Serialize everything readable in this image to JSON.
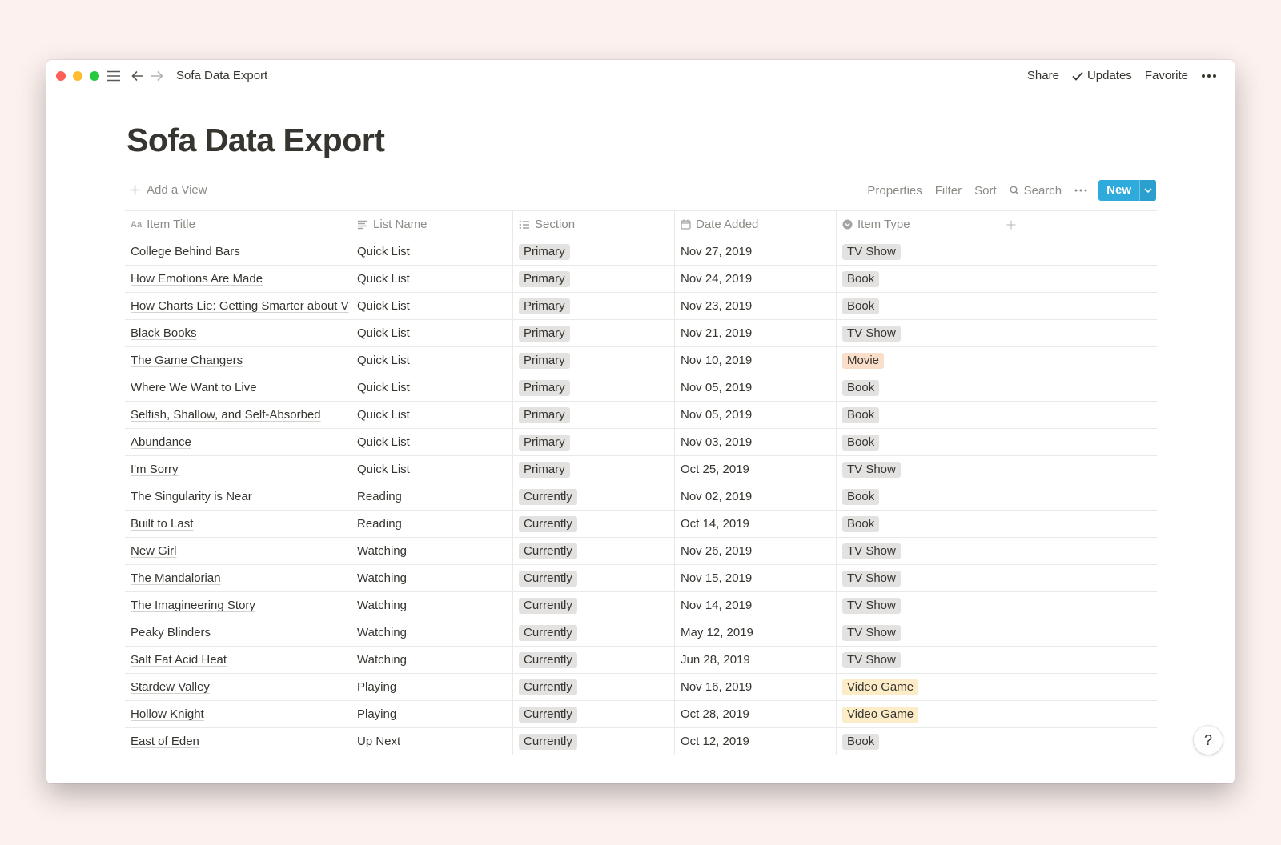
{
  "window": {
    "title": "Sofa Data Export",
    "actions": {
      "share": "Share",
      "updates": "Updates",
      "favorite": "Favorite"
    }
  },
  "page": {
    "title": "Sofa Data Export"
  },
  "viewbar": {
    "add_view": "Add a View",
    "properties": "Properties",
    "filter": "Filter",
    "sort": "Sort",
    "search": "Search",
    "new": "New"
  },
  "table": {
    "columns": [
      "Item Title",
      "List Name",
      "Section",
      "Date Added",
      "Item Type"
    ],
    "rows": [
      {
        "title": "College Behind Bars",
        "list": "Quick List",
        "section": "Primary",
        "date": "Nov 27, 2019",
        "type": "TV Show",
        "type_color": "#e3e2e0"
      },
      {
        "title": "How Emotions Are Made",
        "list": "Quick List",
        "section": "Primary",
        "date": "Nov 24, 2019",
        "type": "Book",
        "type_color": "#e3e2e0"
      },
      {
        "title": "How Charts Lie: Getting Smarter about V",
        "list": "Quick List",
        "section": "Primary",
        "date": "Nov 23, 2019",
        "type": "Book",
        "type_color": "#e3e2e0"
      },
      {
        "title": "Black Books",
        "list": "Quick List",
        "section": "Primary",
        "date": "Nov 21, 2019",
        "type": "TV Show",
        "type_color": "#e3e2e0"
      },
      {
        "title": "The Game Changers",
        "list": "Quick List",
        "section": "Primary",
        "date": "Nov 10, 2019",
        "type": "Movie",
        "type_color": "#fadec9"
      },
      {
        "title": "Where We Want to Live",
        "list": "Quick List",
        "section": "Primary",
        "date": "Nov 05, 2019",
        "type": "Book",
        "type_color": "#e3e2e0"
      },
      {
        "title": "Selfish, Shallow, and Self-Absorbed",
        "list": "Quick List",
        "section": "Primary",
        "date": "Nov 05, 2019",
        "type": "Book",
        "type_color": "#e3e2e0"
      },
      {
        "title": "Abundance",
        "list": "Quick List",
        "section": "Primary",
        "date": "Nov 03, 2019",
        "type": "Book",
        "type_color": "#e3e2e0"
      },
      {
        "title": "I'm Sorry",
        "list": "Quick List",
        "section": "Primary",
        "date": "Oct 25, 2019",
        "type": "TV Show",
        "type_color": "#e3e2e0"
      },
      {
        "title": "The Singularity is Near",
        "list": "Reading",
        "section": "Currently",
        "date": "Nov 02, 2019",
        "type": "Book",
        "type_color": "#e3e2e0"
      },
      {
        "title": "Built to Last",
        "list": "Reading",
        "section": "Currently",
        "date": "Oct 14, 2019",
        "type": "Book",
        "type_color": "#e3e2e0"
      },
      {
        "title": "New Girl",
        "list": "Watching",
        "section": "Currently",
        "date": "Nov 26, 2019",
        "type": "TV Show",
        "type_color": "#e3e2e0"
      },
      {
        "title": "The Mandalorian",
        "list": "Watching",
        "section": "Currently",
        "date": "Nov 15, 2019",
        "type": "TV Show",
        "type_color": "#e3e2e0"
      },
      {
        "title": "The Imagineering Story",
        "list": "Watching",
        "section": "Currently",
        "date": "Nov 14, 2019",
        "type": "TV Show",
        "type_color": "#e3e2e0"
      },
      {
        "title": "Peaky Blinders",
        "list": "Watching",
        "section": "Currently",
        "date": "May 12, 2019",
        "type": "TV Show",
        "type_color": "#e3e2e0"
      },
      {
        "title": "Salt Fat Acid Heat",
        "list": "Watching",
        "section": "Currently",
        "date": "Jun 28, 2019",
        "type": "TV Show",
        "type_color": "#e3e2e0"
      },
      {
        "title": "Stardew Valley",
        "list": "Playing",
        "section": "Currently",
        "date": "Nov 16, 2019",
        "type": "Video Game",
        "type_color": "#fdecc8"
      },
      {
        "title": "Hollow Knight",
        "list": "Playing",
        "section": "Currently",
        "date": "Oct 28, 2019",
        "type": "Video Game",
        "type_color": "#fdecc8"
      },
      {
        "title": "East of Eden",
        "list": "Up Next",
        "section": "Currently",
        "date": "Oct 12, 2019",
        "type": "Book",
        "type_color": "#e3e2e0"
      }
    ]
  },
  "help": {
    "label": "?"
  },
  "icons": [
    "menu-icon",
    "back-arrow-icon",
    "forward-arrow-icon",
    "checkmark-icon",
    "more-icon",
    "plus-icon",
    "search-icon",
    "chevron-down-icon",
    "text-type-icon",
    "lines-icon",
    "list-icon",
    "calendar-icon",
    "select-icon"
  ],
  "colors": {
    "accent": "#2eaadc",
    "background": "#fcf1ee"
  }
}
